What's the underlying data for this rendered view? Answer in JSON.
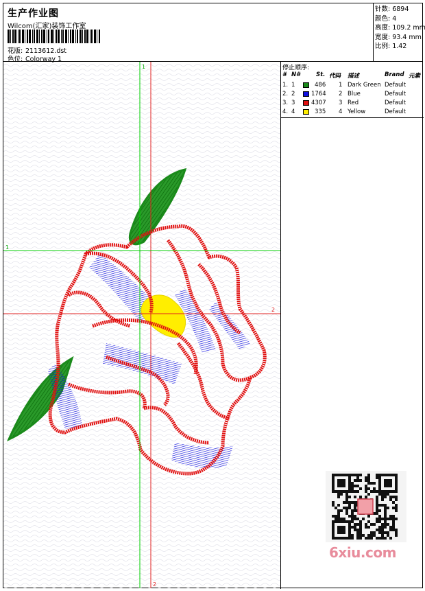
{
  "header": {
    "title": "生产作业图",
    "company": "Wilcom(汇家)装饰工作室",
    "design_label": "花版:",
    "design_value": "2113612.dst",
    "colorway_label": "色位:",
    "colorway_value": "Colorway 1"
  },
  "stats": [
    {
      "label": "针数:",
      "value": "6894"
    },
    {
      "label": "颜色:",
      "value": "4"
    },
    {
      "label": "高度:",
      "value": "109.2 mm"
    },
    {
      "label": "宽度:",
      "value": "93.4 mm"
    },
    {
      "label": "比例:",
      "value": "1.42"
    }
  ],
  "guides": {
    "v1": "1",
    "v2": "2",
    "h1": "1",
    "h2": "2"
  },
  "stop_sequence": {
    "title": "停止顺序:",
    "headers": [
      "#",
      "N#",
      "St.",
      "代码",
      "描述",
      "Brand",
      "元素"
    ],
    "rows": [
      {
        "num": "1.",
        "n": "1",
        "color": "#1a8a1a",
        "st": "486",
        "code": "1",
        "desc": "Dark Green",
        "brand": "Default"
      },
      {
        "num": "2.",
        "n": "2",
        "color": "#1010e0",
        "st": "1764",
        "code": "2",
        "desc": "Blue",
        "brand": "Default"
      },
      {
        "num": "3.",
        "n": "3",
        "color": "#e01010",
        "st": "4307",
        "code": "3",
        "desc": "Red",
        "brand": "Default"
      },
      {
        "num": "4.",
        "n": "4",
        "color": "#ffee00",
        "st": "335",
        "code": "4",
        "desc": "Yellow",
        "brand": "Default"
      }
    ]
  },
  "watermark": "6xiu.com",
  "colors": {
    "green": "#1a8a1a",
    "blue": "#1010e0",
    "red": "#e01010",
    "yellow": "#ffee00",
    "guide_green": "#00cc00",
    "guide_red": "#e02020"
  }
}
